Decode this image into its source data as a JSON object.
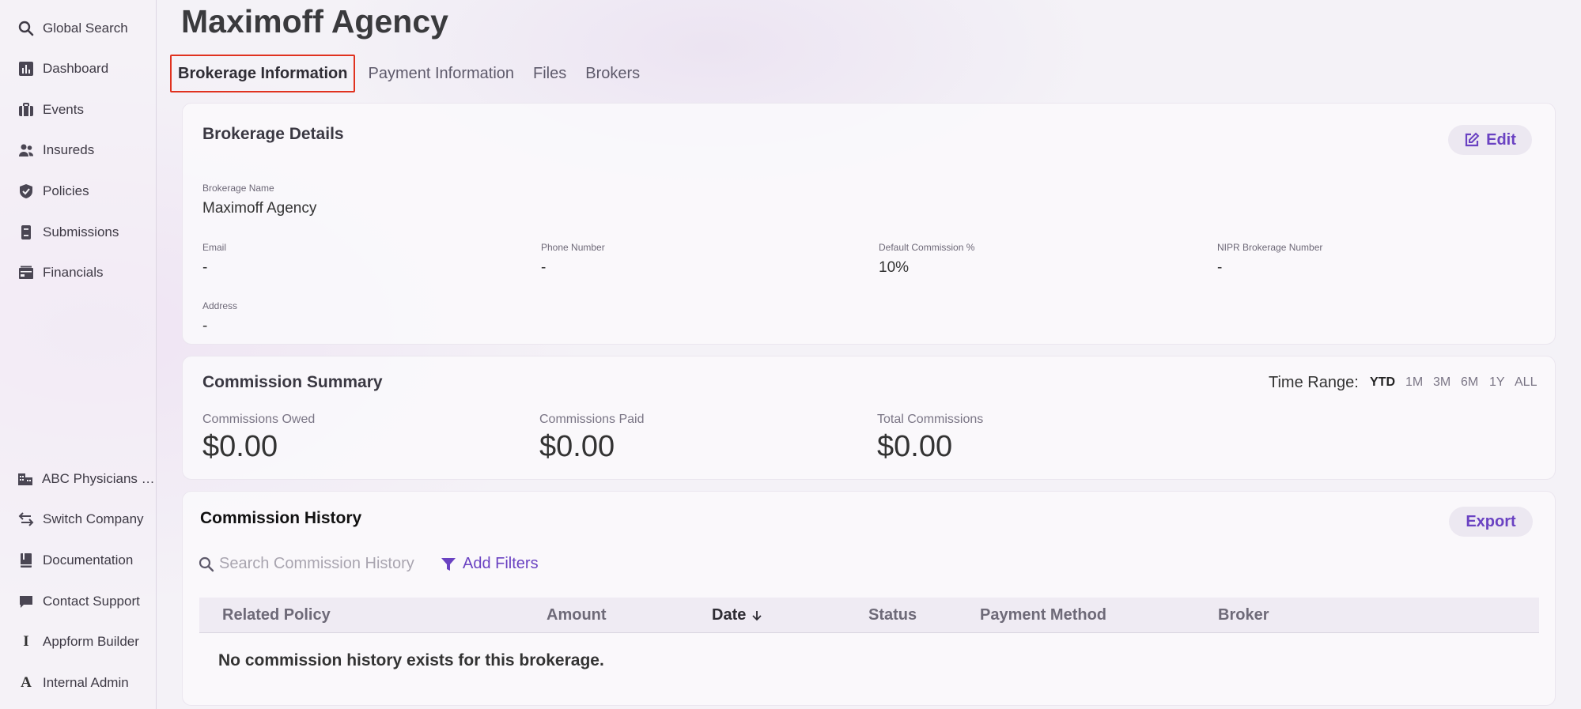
{
  "sidebar": {
    "items": [
      {
        "label": "Global Search",
        "icon": "search-icon"
      },
      {
        "label": "Dashboard",
        "icon": "dashboard-icon"
      },
      {
        "label": "Events",
        "icon": "events-icon"
      },
      {
        "label": "Insureds",
        "icon": "people-icon"
      },
      {
        "label": "Policies",
        "icon": "shield-icon"
      },
      {
        "label": "Submissions",
        "icon": "document-icon"
      },
      {
        "label": "Financials",
        "icon": "financials-icon"
      }
    ],
    "bottom_items": [
      {
        "label": "ABC Physicians …",
        "icon": "company-icon"
      },
      {
        "label": "Switch Company",
        "icon": "switch-icon"
      },
      {
        "label": "Documentation",
        "icon": "book-icon"
      },
      {
        "label": "Contact Support",
        "icon": "chat-icon"
      },
      {
        "label": "Appform Builder",
        "icon": "I"
      },
      {
        "label": "Internal Admin",
        "icon": "A"
      }
    ]
  },
  "page": {
    "title": "Maximoff Agency"
  },
  "tabs": [
    {
      "label": "Brokerage Information",
      "active": true
    },
    {
      "label": "Payment Information",
      "active": false
    },
    {
      "label": "Files",
      "active": false
    },
    {
      "label": "Brokers",
      "active": false
    }
  ],
  "brokerage_details": {
    "title": "Brokerage Details",
    "edit_label": "Edit",
    "name_label": "Brokerage Name",
    "name_value": "Maximoff Agency",
    "email_label": "Email",
    "email_value": "-",
    "phone_label": "Phone Number",
    "phone_value": "-",
    "commission_label": "Default Commission %",
    "commission_value": "10%",
    "nipr_label": "NIPR Brokerage Number",
    "nipr_value": "-",
    "address_label": "Address",
    "address_value": "-"
  },
  "commission_summary": {
    "title": "Commission Summary",
    "time_range_label": "Time Range:",
    "ranges": [
      "YTD",
      "1M",
      "3M",
      "6M",
      "1Y",
      "ALL"
    ],
    "selected_range": "YTD",
    "owed_label": "Commissions Owed",
    "owed_value": "$0.00",
    "paid_label": "Commissions Paid",
    "paid_value": "$0.00",
    "total_label": "Total Commissions",
    "total_value": "$0.00"
  },
  "commission_history": {
    "title": "Commission History",
    "export_label": "Export",
    "search_placeholder": "Search Commission History",
    "add_filters_label": "Add Filters",
    "columns": [
      "Related Policy",
      "Amount",
      "Date",
      "Status",
      "Payment Method",
      "Broker"
    ],
    "sorted_column": "Date",
    "sort_direction": "descending",
    "empty_message": "No commission history exists for this brokerage."
  },
  "colors": {
    "accent": "#6a42c2",
    "active_tab_border": "#e0321f"
  }
}
